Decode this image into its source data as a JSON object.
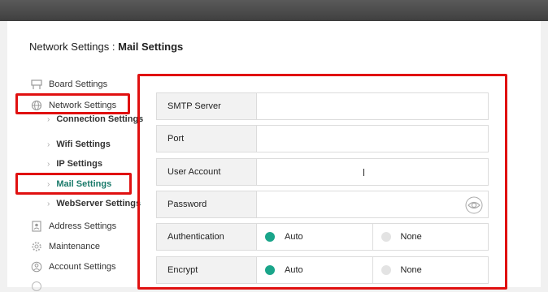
{
  "page": {
    "title_prefix": "Network Settings : ",
    "title_bold": "Mail Settings"
  },
  "sidebar": {
    "items": [
      {
        "label": "Board Settings",
        "icon": "board-icon"
      },
      {
        "label": "Network Settings",
        "icon": "globe-icon"
      },
      {
        "label": "Address Settings",
        "icon": "address-book-icon"
      },
      {
        "label": "Maintenance",
        "icon": "gear-icon"
      },
      {
        "label": "Account Settings",
        "icon": "user-icon"
      }
    ],
    "network_sub": [
      {
        "label": "Connection Settings"
      },
      {
        "label": "Wifi Settings"
      },
      {
        "label": "IP Settings"
      },
      {
        "label": "Mail Settings",
        "active": true
      },
      {
        "label": "WebServer Settings"
      }
    ]
  },
  "form": {
    "smtp_label": "SMTP Server",
    "port_label": "Port",
    "user_label": "User Account",
    "password_label": "Password",
    "auth_label": "Authentication",
    "auth_auto": "Auto",
    "auth_none": "None",
    "encrypt_label": "Encrypt",
    "encrypt_auto": "Auto",
    "encrypt_none": "None"
  },
  "colors": {
    "accent": "#1aa58a",
    "highlight_border": "#e01010",
    "active_text": "#1a7a6a"
  }
}
